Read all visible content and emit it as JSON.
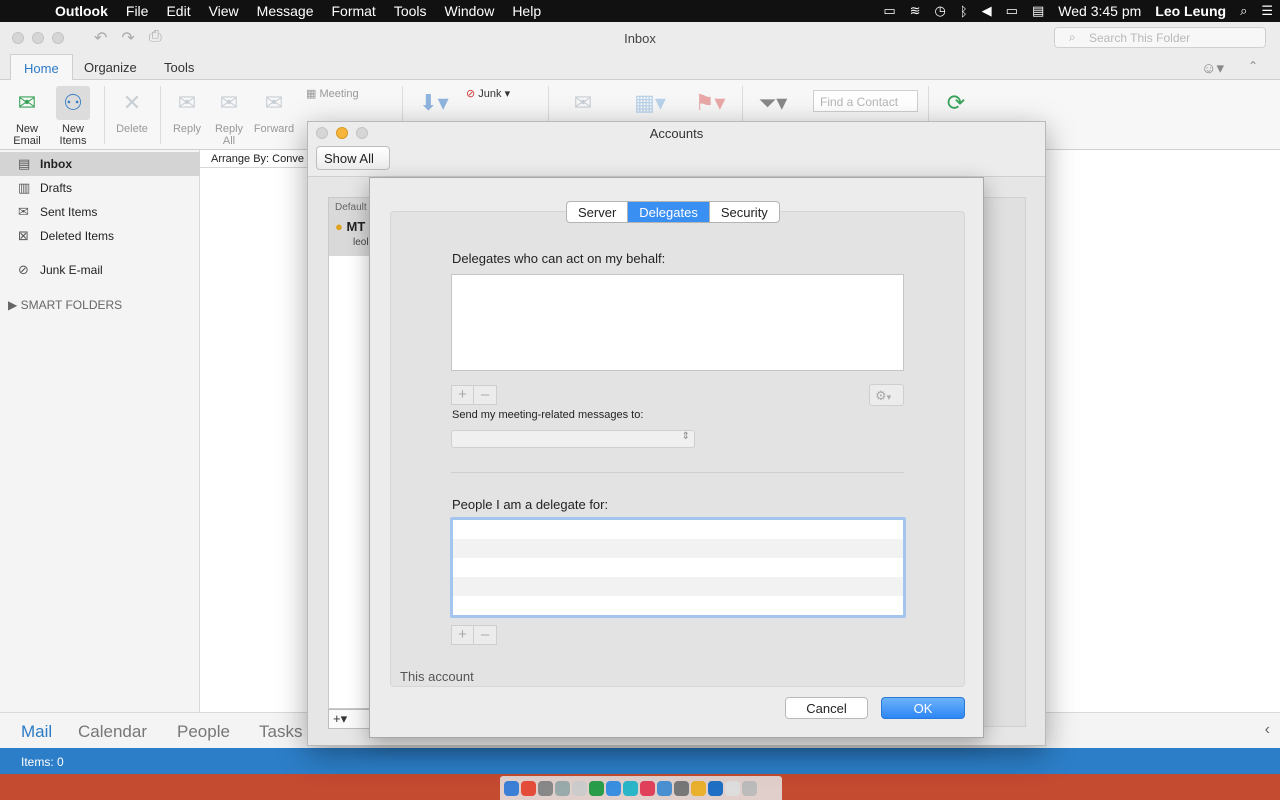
{
  "menubar": {
    "app": "Outlook",
    "items": [
      "File",
      "Edit",
      "View",
      "Message",
      "Format",
      "Tools",
      "Window",
      "Help"
    ],
    "clock": "Wed 3:45 pm",
    "user": "Leo Leung"
  },
  "window": {
    "title": "Inbox",
    "search_placeholder": "Search This Folder"
  },
  "ribbon_tabs": [
    "Home",
    "Organize",
    "Tools"
  ],
  "ribbon": {
    "new_email": "New\nEmail",
    "new_items": "New\nItems",
    "delete": "Delete",
    "reply": "Reply",
    "reply_all": "Reply\nAll",
    "forward": "Forward",
    "meeting": "Meeting",
    "junk": "Junk",
    "find_contact_placeholder": "Find a Contact"
  },
  "sidebar": {
    "folders": [
      "Inbox",
      "Drafts",
      "Sent Items",
      "Deleted Items",
      "Junk E-mail"
    ],
    "smart_folders": "SMART FOLDERS"
  },
  "list": {
    "arrange_by": "Arrange By: Conve"
  },
  "bottom_nav": [
    "Mail",
    "Calendar",
    "People",
    "Tasks"
  ],
  "status": {
    "items": "Items: 0"
  },
  "accounts": {
    "title": "Accounts",
    "show_all": "Show All",
    "list_header": "Default",
    "account_name": "MT",
    "account_email": "leol",
    "add_symbol": "+"
  },
  "sheet": {
    "tabs": [
      "Server",
      "Delegates",
      "Security"
    ],
    "active_tab": "Delegates",
    "delegates_label": "Delegates who can act on my behalf:",
    "meeting_label": "Send my meeting-related messages to:",
    "delegate_for_label": "People I am a delegate for:",
    "this_account": "This account",
    "cancel": "Cancel",
    "ok": "OK",
    "plus": "+",
    "minus": "–"
  },
  "colors": {
    "accent": "#2b7bc6",
    "status_bar": "#2c7ec8",
    "segment_active": "#3a8ff2",
    "ok_button": "#2d86f5"
  }
}
